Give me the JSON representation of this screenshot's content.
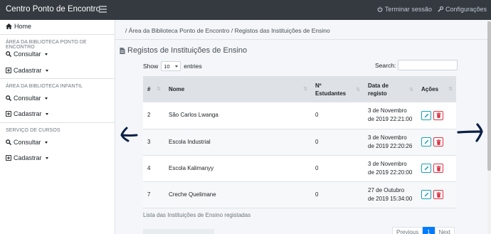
{
  "topbar": {
    "brand": "Centro Ponto de Encontro",
    "logout": "Terminar sessão",
    "settings": "Configurações"
  },
  "sidebar": {
    "home": "Home",
    "sections": [
      {
        "heading": "ÁREA DA BIBLIOTECA PONTO DE ENCONTRO",
        "consult": "Consultar",
        "register": "Cadastrar"
      },
      {
        "heading": "ÁREA DA BIBLIOTECA INFANTIL",
        "consult": "Consultar",
        "register": "Cadastrar"
      },
      {
        "heading": "SERVIÇO DE CURSOS",
        "consult": "Consultar",
        "register": "Cadastrar"
      }
    ]
  },
  "breadcrumb": "/ Área da Biblioteca Ponto de Encontro / Registos das Instituições de Ensino",
  "page_title": "Registos de Instituições de Ensino",
  "controls": {
    "show_label": "Show",
    "show_value": "10",
    "entries_label": "entries",
    "search_label": "Search:"
  },
  "table": {
    "headers": [
      "#",
      "Nome",
      "Nº Estudantes",
      "Data de registo",
      "Ações"
    ],
    "rows": [
      {
        "id": "2",
        "name": "São Carlos Lwanga",
        "students": "0",
        "date1": "3 de Novembro",
        "date2": "de 2019 22:21:00"
      },
      {
        "id": "3",
        "name": "Escola Industrial",
        "students": "0",
        "date1": "3 de Novembro",
        "date2": "de 2019 22:20:26"
      },
      {
        "id": "4",
        "name": "Escola Kalimanyy",
        "students": "0",
        "date1": "3 de Novembro",
        "date2": "de 2019 22:20:00"
      },
      {
        "id": "7",
        "name": "Creche Quelimane",
        "students": "0",
        "date1": "27 de Outubro",
        "date2": "de 2019 15:34:00"
      }
    ]
  },
  "caption": "Lista das Instituições de Ensino registadas",
  "pagination": {
    "previous": "Previous",
    "page": "1",
    "next": "Next"
  },
  "colors": {
    "topbar": "#343a40",
    "primary": "#007bff",
    "info": "#17a2b8",
    "danger": "#dc3545",
    "annotation": "#0a1f44"
  }
}
